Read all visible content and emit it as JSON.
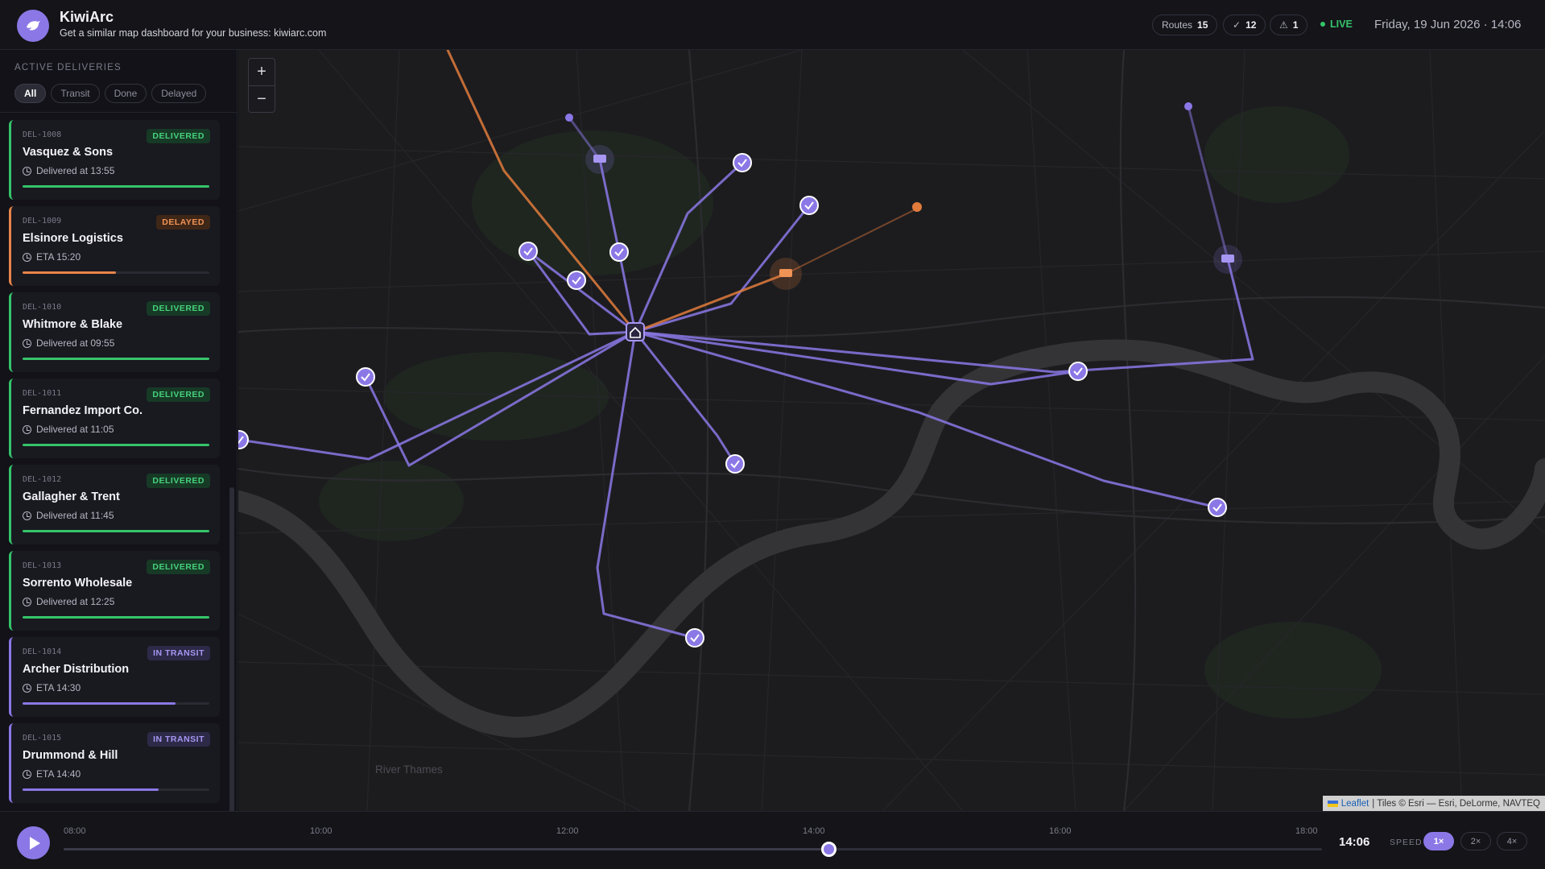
{
  "app": {
    "title": "KiwiArc",
    "subtitle": "Get a similar map dashboard for your business: kiwiarc.com"
  },
  "header": {
    "routes_label": "Routes",
    "routes_count": "15",
    "done_icon": "check-icon",
    "done_count": "12",
    "alert_icon": "warning-icon",
    "alert_count": "1",
    "live_label": "LIVE",
    "datetime": "Friday, 19 Jun 2026 · 14:06"
  },
  "sidebar": {
    "title": "ACTIVE DELIVERIES",
    "filters": [
      "All",
      "Transit",
      "Done",
      "Delayed"
    ],
    "active_filter": "All",
    "deliveries": [
      {
        "id": "DEL-1008",
        "status": "DELIVERED",
        "name": "Vasquez & Sons",
        "meta": "Delivered at 13:55",
        "progress": 1.0
      },
      {
        "id": "DEL-1009",
        "status": "DELAYED",
        "name": "Elsinore Logistics",
        "meta": "ETA 15:20",
        "progress": 0.5
      },
      {
        "id": "DEL-1010",
        "status": "DELIVERED",
        "name": "Whitmore & Blake",
        "meta": "Delivered at 09:55",
        "progress": 1.0
      },
      {
        "id": "DEL-1011",
        "status": "DELIVERED",
        "name": "Fernandez Import Co.",
        "meta": "Delivered at 11:05",
        "progress": 1.0
      },
      {
        "id": "DEL-1012",
        "status": "DELIVERED",
        "name": "Gallagher & Trent",
        "meta": "Delivered at 11:45",
        "progress": 1.0
      },
      {
        "id": "DEL-1013",
        "status": "DELIVERED",
        "name": "Sorrento Wholesale",
        "meta": "Delivered at 12:25",
        "progress": 1.0
      },
      {
        "id": "DEL-1014",
        "status": "IN TRANSIT",
        "name": "Archer Distribution",
        "meta": "ETA 14:30",
        "progress": 0.82
      },
      {
        "id": "DEL-1015",
        "status": "IN TRANSIT",
        "name": "Drummond & Hill",
        "meta": "ETA 14:40",
        "progress": 0.73
      }
    ]
  },
  "map": {
    "zoom_in": "+",
    "zoom_out": "−",
    "river_label": "River Thames",
    "attribution_link": "Leaflet",
    "attribution_text": "| Tiles © Esri — Esri, DeLorme, NAVTEQ",
    "colors": {
      "route": "#8b78e6",
      "delayed": "#e07b3c",
      "delivered": "#35c46a"
    }
  },
  "timeline": {
    "ticks": [
      "08:00",
      "10:00",
      "12:00",
      "14:00",
      "16:00",
      "18:00"
    ],
    "progress": 0.6083,
    "current_time": "14:06",
    "speed_label": "SPEED",
    "speeds": [
      "1×",
      "2×",
      "4×"
    ],
    "active_speed": "1×"
  }
}
